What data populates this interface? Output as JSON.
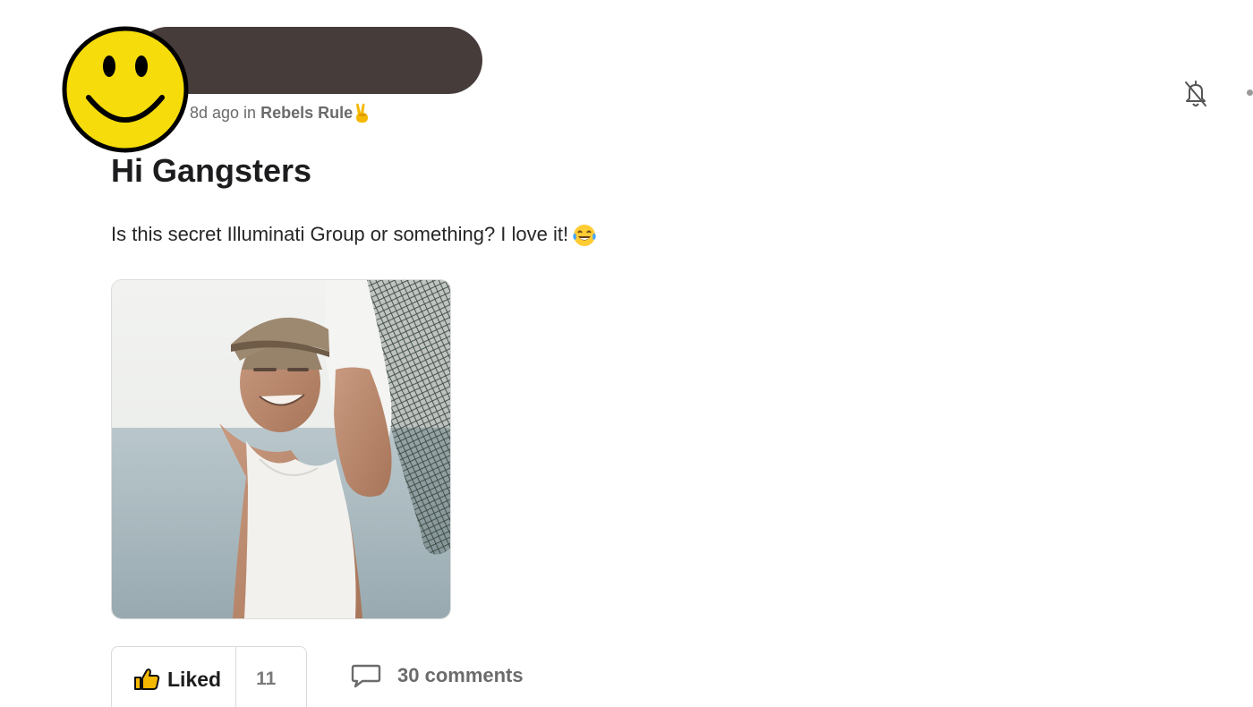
{
  "post": {
    "age": "8d ago in",
    "group": "Rebels Rule",
    "group_emoji": "victory-hand",
    "title": "Hi Gangsters",
    "body": "Is this secret Illuminati Group or something? I love it!",
    "body_emoji": "tears-of-joy-face"
  },
  "actions": {
    "like_label": "Liked",
    "like_count": "11",
    "comments_label": "30 comments"
  },
  "colors": {
    "name_redaction": "#463c3a",
    "avatar_yellow": "#f5dc0a"
  }
}
